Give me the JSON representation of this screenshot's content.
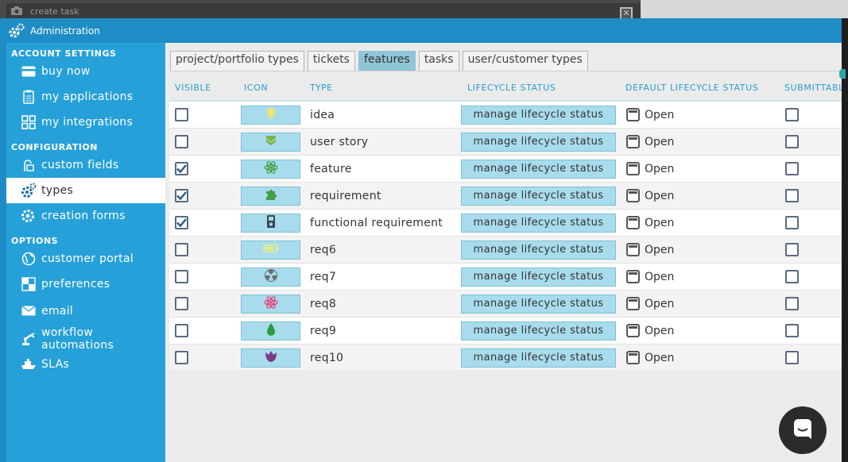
{
  "background_window": {
    "title": "create task",
    "close_label": "✕"
  },
  "modal": {
    "title": "Administration"
  },
  "sidebar": {
    "sections": [
      {
        "label": "ACCOUNT SETTINGS",
        "items": [
          {
            "label": "buy now",
            "icon": "credit-card-icon"
          },
          {
            "label": "my applications",
            "icon": "clipboard-icon"
          },
          {
            "label": "my integrations",
            "icon": "puzzle-grid-icon"
          }
        ]
      },
      {
        "label": "CONFIGURATION",
        "items": [
          {
            "label": "custom fields",
            "icon": "custom-field-icon"
          },
          {
            "label": "types",
            "icon": "cog-icon",
            "active": true
          },
          {
            "label": "creation forms",
            "icon": "cog-form-icon"
          }
        ]
      },
      {
        "label": "OPTIONS",
        "items": [
          {
            "label": "customer portal",
            "icon": "globe-icon"
          },
          {
            "label": "preferences",
            "icon": "checker-icon"
          },
          {
            "label": "email",
            "icon": "envelope-icon"
          },
          {
            "label": "workflow automations",
            "icon": "robot-arm-icon"
          },
          {
            "label": "SLAs",
            "icon": "ship-icon"
          }
        ]
      }
    ]
  },
  "tabs": [
    {
      "label": "project/portfolio types",
      "active": false
    },
    {
      "label": "tickets",
      "active": false
    },
    {
      "label": "features",
      "active": true
    },
    {
      "label": "tasks",
      "active": false
    },
    {
      "label": "user/customer types",
      "active": false
    }
  ],
  "table": {
    "headers": {
      "visible": "VISIBLE",
      "icon": "ICON",
      "type": "TYPE",
      "lifecycle": "LIFECYCLE STATUS",
      "default_lifecycle": "DEFAULT LIFECYCLE STATUS",
      "submittable": "SUBMITTABLE"
    },
    "rows": [
      {
        "visible": false,
        "icon": "lightbulb-icon",
        "icon_color": "#f4e36a",
        "type": "idea",
        "lifecycle_button": "manage lifecycle status",
        "default_status": "Open",
        "submittable": false
      },
      {
        "visible": false,
        "icon": "shield-chevron-icon",
        "icon_color": "#7cb342",
        "type": "user story",
        "lifecycle_button": "manage lifecycle status",
        "default_status": "Open",
        "submittable": false
      },
      {
        "visible": true,
        "icon": "atom-icon",
        "icon_color": "#43a047",
        "type": "feature",
        "lifecycle_button": "manage lifecycle status",
        "default_status": "Open",
        "submittable": false
      },
      {
        "visible": true,
        "icon": "puzzle-icon",
        "icon_color": "#43a047",
        "type": "requirement",
        "lifecycle_button": "manage lifecycle status",
        "default_status": "Open",
        "submittable": false
      },
      {
        "visible": true,
        "icon": "ipod-icon",
        "icon_color": "#37474f",
        "type": "functional requirement",
        "lifecycle_button": "manage lifecycle status",
        "default_status": "Open",
        "submittable": false
      },
      {
        "visible": false,
        "icon": "battery-icon",
        "icon_color": "#e8ef7a",
        "type": "req6",
        "lifecycle_button": "manage lifecycle status",
        "default_status": "Open",
        "submittable": false
      },
      {
        "visible": false,
        "icon": "radiation-icon",
        "icon_color": "#6d6d6d",
        "type": "req7",
        "lifecycle_button": "manage lifecycle status",
        "default_status": "Open",
        "submittable": false
      },
      {
        "visible": false,
        "icon": "atom-icon",
        "icon_color": "#e0457b",
        "type": "req8",
        "lifecycle_button": "manage lifecycle status",
        "default_status": "Open",
        "submittable": false
      },
      {
        "visible": false,
        "icon": "drop-icon",
        "icon_color": "#2e9a3e",
        "type": "req9",
        "lifecycle_button": "manage lifecycle status",
        "default_status": "Open",
        "submittable": false
      },
      {
        "visible": false,
        "icon": "tulip-icon",
        "icon_color": "#7b3a8a",
        "type": "req10",
        "lifecycle_button": "manage lifecycle status",
        "default_status": "Open",
        "submittable": false
      }
    ]
  },
  "chat_widget": {
    "icon": "chat-icon"
  }
}
